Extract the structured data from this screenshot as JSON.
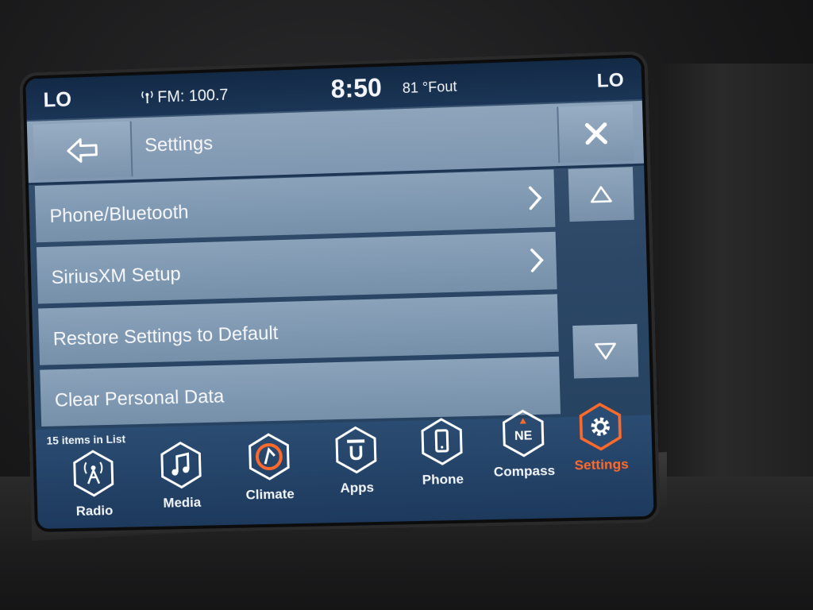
{
  "status_bar": {
    "left_climate": "LO",
    "radio": "FM: 100.7",
    "clock": "8:50",
    "temperature": "81 °Fout",
    "right_climate": "LO"
  },
  "header": {
    "title": "Settings",
    "back_icon": "back-arrow-icon",
    "close_icon": "close-icon"
  },
  "settings_list": {
    "items": [
      {
        "label": "Phone/Bluetooth",
        "has_chevron": true
      },
      {
        "label": "SiriusXM Setup",
        "has_chevron": true
      },
      {
        "label": "Restore Settings to Default",
        "has_chevron": false
      },
      {
        "label": "Clear Personal Data",
        "has_chevron": false
      }
    ],
    "count_text": "15 items in List"
  },
  "dock": {
    "items": [
      {
        "label": "Radio",
        "icon": "radio-tower-icon"
      },
      {
        "label": "Media",
        "icon": "music-note-icon"
      },
      {
        "label": "Climate",
        "icon": "climate-icon"
      },
      {
        "label": "Apps",
        "icon": "apps-icon"
      },
      {
        "label": "Phone",
        "icon": "phone-icon"
      },
      {
        "label": "Compass",
        "icon": "compass-icon",
        "heading": "NE"
      },
      {
        "label": "Settings",
        "icon": "gear-icon",
        "active": true
      }
    ]
  },
  "colors": {
    "accent": "#ff6a2a",
    "screen_bg": "#2c4766",
    "row_bg": "#7f97b1",
    "text": "#f3f6fa"
  }
}
